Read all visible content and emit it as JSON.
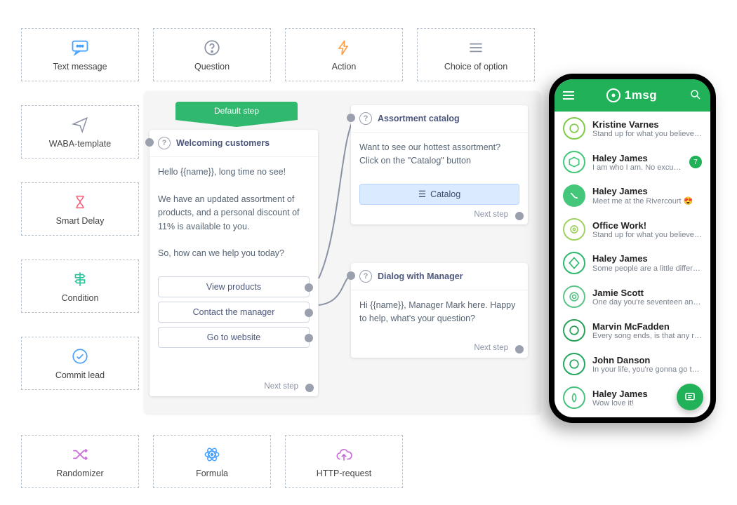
{
  "palette": {
    "text_message": "Text message",
    "question": "Question",
    "action": "Action",
    "choice_of_option": "Choice of option",
    "waba_template": "WABA-template",
    "smart_delay": "Smart Delay",
    "condition": "Condition",
    "commit_lead": "Commit lead",
    "randomizer": "Randomizer",
    "formula": "Formula",
    "http_request": "HTTP-request"
  },
  "canvas": {
    "default_step": "Default step",
    "next_step": "Next step",
    "welcome": {
      "title": "Welcoming customers",
      "line1": "Hello {{name}}, long time no see!",
      "line2": "We have an updated assortment of products, and a personal discount of 11% is available to you.",
      "line3": "So, how can we help you today?",
      "btn_view": "View products",
      "btn_contact": "Contact the manager",
      "btn_site": "Go to website"
    },
    "assortment": {
      "title": "Assortment catalog",
      "text": "Want to see our hottest assortment? Click on the \"Catalog\" button",
      "btn_catalog": "Catalog"
    },
    "dialog": {
      "title": "Dialog with Manager",
      "text": "Hi {{name}}, Manager Mark here. Happy to help, what's your question?"
    }
  },
  "phone": {
    "brand": "1msg",
    "chats": [
      {
        "name": "Kristine Varnes",
        "msg": "Stand up for what you believe in",
        "badge": "",
        "avatar": "a"
      },
      {
        "name": "Haley James",
        "msg": "I am who I am. No excuses .",
        "badge": "7",
        "avatar": "b"
      },
      {
        "name": "Haley James",
        "msg": "Meet me at the Rivercourt 😍",
        "badge": "",
        "avatar": "c"
      },
      {
        "name": "Office Work!",
        "msg": "Stand up for what you believe in",
        "badge": "",
        "avatar": "d"
      },
      {
        "name": "Haley James",
        "msg": "Some people are a little different🔥",
        "badge": "",
        "avatar": "e"
      },
      {
        "name": "Jamie Scott",
        "msg": "One day you're seventeen and...",
        "badge": "",
        "avatar": "f"
      },
      {
        "name": "Marvin McFadden",
        "msg": "Every song ends, is that any reason...",
        "badge": "",
        "avatar": "g"
      },
      {
        "name": "John Danson",
        "msg": "In your life, you're gonna go to s...",
        "badge": "",
        "avatar": "h"
      },
      {
        "name": "Haley James",
        "msg": "Wow love it!",
        "badge": "",
        "avatar": "i"
      }
    ]
  }
}
